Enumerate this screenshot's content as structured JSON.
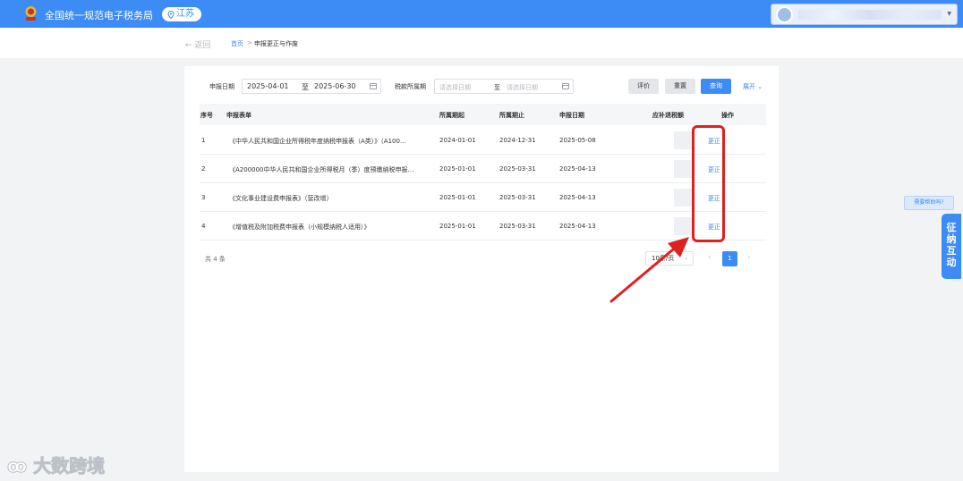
{
  "header": {
    "title": "全国统一规范电子税务局",
    "province": "江苏",
    "logo_icon": "tax-emblem-icon"
  },
  "breadcrumb": {
    "back": "返回",
    "home": "首页",
    "separator": ">",
    "current": "申报更正与作废"
  },
  "filters": {
    "declare_date_label": "申报日期",
    "declare_start": "2025-04-01",
    "to_1": "至",
    "declare_end": "2025-06-30",
    "tax_period_label": "税款所属期",
    "period_start_placeholder": "请选择日期",
    "to_2": "至",
    "period_end_placeholder": "请选择日期"
  },
  "buttons": {
    "evaluate": "评价",
    "reset": "重置",
    "query": "查询",
    "expand": "展开"
  },
  "table": {
    "headers": {
      "index": "序号",
      "form": "申报表单",
      "period_start": "所属期起",
      "period_end": "所属期止",
      "declare_date": "申报日期",
      "amount": "应补退税额",
      "action": "操作"
    },
    "rows": [
      {
        "index": "1",
        "form": "《中华人民共和国企业所得税年度纳税申报表（A类）》（A100…",
        "start": "2024-01-01",
        "end": "2024-12-31",
        "date": "2025-05-08",
        "action": "更正"
      },
      {
        "index": "2",
        "form": "《A200000中华人民共和国企业所得税月（季）度预缴纳税申报…",
        "start": "2025-01-01",
        "end": "2025-03-31",
        "date": "2025-04-13",
        "action": "更正"
      },
      {
        "index": "3",
        "form": "《文化事业建设费申报表》（营改增）",
        "start": "2025-01-01",
        "end": "2025-03-31",
        "date": "2025-04-13",
        "action": "更正"
      },
      {
        "index": "4",
        "form": "《增值税及附加税费申报表（小规模纳税人适用）》",
        "start": "2025-01-01",
        "end": "2025-03-31",
        "date": "2025-04-13",
        "action": "更正"
      }
    ]
  },
  "pagination": {
    "total": "共 4 条",
    "page_size": "10条/页",
    "current_page": "1",
    "prev": "‹",
    "next": "›"
  },
  "side": {
    "help": "需要帮助吗?",
    "tab_chars": [
      "征",
      "纳",
      "互",
      "动"
    ]
  },
  "watermark": "大数跨境",
  "colors": {
    "brand": "#3d8bf5",
    "annotation": "#e02020"
  }
}
